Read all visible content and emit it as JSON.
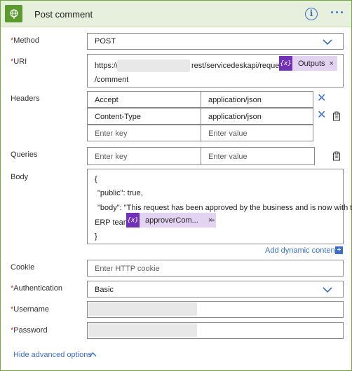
{
  "header": {
    "title": "Post comment",
    "info_label": "i",
    "more_label": "···"
  },
  "fields": {
    "method": {
      "label": "Method",
      "value": "POST"
    },
    "uri": {
      "label": "URI",
      "prefix": "https://",
      "middle": "rest/servicedeskapi/request/",
      "token": "Outputs",
      "suffix": "/comment"
    },
    "headers": {
      "label": "Headers",
      "rows": [
        {
          "key": "Accept",
          "value": "application/json"
        },
        {
          "key": "Content-Type",
          "value": "application/json"
        }
      ],
      "key_placeholder": "Enter key",
      "value_placeholder": "Enter value"
    },
    "queries": {
      "label": "Queries",
      "key_placeholder": "Enter key",
      "value_placeholder": "Enter value"
    },
    "body": {
      "label": "Body",
      "line1": "{",
      "line2": "\"public\": true,",
      "line3": "\"body\": \"This request has been approved by the business and is now with the",
      "line4_prefix": "ERP team.",
      "token": "approverCom...",
      "line4_suffix": "\"",
      "line5": "}"
    },
    "add_dynamic": "Add dynamic content",
    "cookie": {
      "label": "Cookie",
      "placeholder": "Enter HTTP cookie"
    },
    "authentication": {
      "label": "Authentication",
      "value": "Basic"
    },
    "username": {
      "label": "Username"
    },
    "password": {
      "label": "Password"
    },
    "hide_advanced": "Hide advanced options"
  },
  "required_marker": "*",
  "token_x": "×",
  "token_icon": "{x}",
  "colors": {
    "accent": "#3b6fc9",
    "header_bg": "#e7f0dd",
    "border": "#70a93e",
    "token_bg": "#e3d3f2",
    "token_icon": "#7232b8",
    "required": "#d13438"
  }
}
